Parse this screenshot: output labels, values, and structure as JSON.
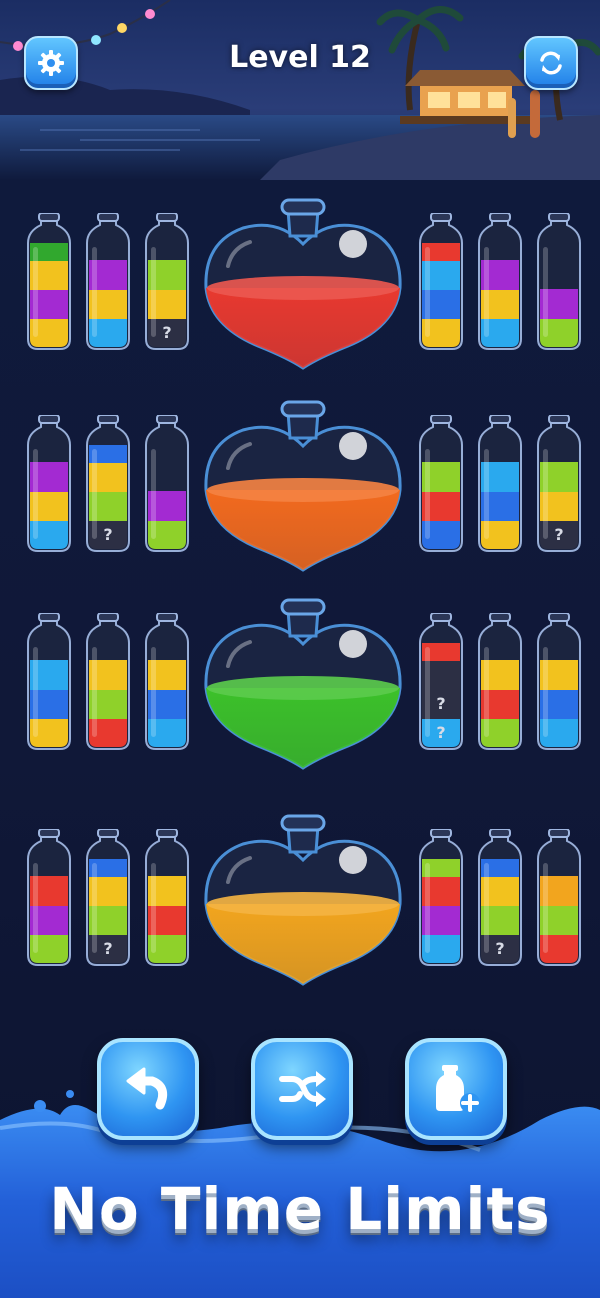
{
  "header": {
    "level_label": "Level 12",
    "settings_icon": "gear-icon",
    "restart_icon": "restart-icon"
  },
  "rows": [
    {
      "left": [
        {
          "layers": [
            "#f2c21e",
            "#a32ad2",
            "#f2c21e",
            "#31a82e",
            "#e8392f"
          ],
          "mystery": 0
        },
        {
          "layers": [
            "#2aa9ee",
            "#f2c21e",
            "#a32ad2"
          ],
          "mystery": 0
        },
        {
          "layers": [
            "#2c2f44",
            "#f2c21e",
            "#8fd12a"
          ],
          "mystery": 1
        }
      ],
      "heart": "#e8392f",
      "right": [
        {
          "layers": [
            "#f2c21e",
            "#2a6fe6",
            "#2aa9ee",
            "#e8392f"
          ],
          "mystery": 0
        },
        {
          "layers": [
            "#2aa9ee",
            "#f2c21e",
            "#a32ad2"
          ],
          "mystery": 0
        },
        {
          "layers": [
            "#8fd12a",
            "#a32ad2"
          ],
          "mystery": 0
        }
      ]
    },
    {
      "left": [
        {
          "layers": [
            "#2aa9ee",
            "#f2c21e",
            "#a32ad2"
          ],
          "mystery": 0
        },
        {
          "layers": [
            "#2c2f44",
            "#8fd12a",
            "#f2c21e",
            "#2a6fe6"
          ],
          "mystery": 1
        },
        {
          "layers": [
            "#8fd12a",
            "#a32ad2"
          ],
          "mystery": 0
        }
      ],
      "heart": "#f26a1e",
      "right": [
        {
          "layers": [
            "#2a6fe6",
            "#e8392f",
            "#8fd12a"
          ],
          "mystery": 0
        },
        {
          "layers": [
            "#f2c21e",
            "#2a6fe6",
            "#2aa9ee"
          ],
          "mystery": 0
        },
        {
          "layers": [
            "#2c2f44",
            "#f2c21e",
            "#8fd12a"
          ],
          "mystery": 1
        }
      ]
    },
    {
      "left": [
        {
          "layers": [
            "#f2c21e",
            "#2a6fe6",
            "#2aa9ee"
          ],
          "mystery": 0
        },
        {
          "layers": [
            "#e8392f",
            "#8fd12a",
            "#f2c21e"
          ],
          "mystery": 0
        },
        {
          "layers": [
            "#2aa9ee",
            "#2a6fe6",
            "#f2c21e"
          ],
          "mystery": 0
        }
      ],
      "heart": "#3cc12a",
      "right": [
        {
          "layers": [
            "#2aa9ee",
            "#2c2f44",
            "#2c2f44",
            "#e8392f"
          ],
          "mystery": 2
        },
        {
          "layers": [
            "#8fd12a",
            "#e8392f",
            "#f2c21e"
          ],
          "mystery": 0
        },
        {
          "layers": [
            "#2aa9ee",
            "#2a6fe6",
            "#f2c21e"
          ],
          "mystery": 0
        }
      ]
    },
    {
      "left": [
        {
          "layers": [
            "#8fd12a",
            "#a32ad2",
            "#e8392f"
          ],
          "mystery": 0
        },
        {
          "layers": [
            "#2c2f44",
            "#8fd12a",
            "#f2c21e",
            "#2a6fe6"
          ],
          "mystery": 1
        },
        {
          "layers": [
            "#8fd12a",
            "#e8392f",
            "#f2c21e"
          ],
          "mystery": 0
        }
      ],
      "heart": "#f2a51e",
      "right": [
        {
          "layers": [
            "#2aa9ee",
            "#a32ad2",
            "#e8392f",
            "#8fd12a"
          ],
          "mystery": 0
        },
        {
          "layers": [
            "#2c2f44",
            "#8fd12a",
            "#f2c21e",
            "#2a6fe6"
          ],
          "mystery": 1
        },
        {
          "layers": [
            "#e8392f",
            "#8fd12a",
            "#f2a51e"
          ],
          "mystery": 0
        }
      ]
    }
  ],
  "mystery_glyph": "?",
  "tools": [
    {
      "name": "undo-button",
      "icon": "undo-icon"
    },
    {
      "name": "shuffle-button",
      "icon": "shuffle-icon"
    },
    {
      "name": "add-bottle-button",
      "icon": "add-bottle-icon"
    }
  ],
  "footer": {
    "tagline": "No Time Limits"
  },
  "colors": {
    "accent": "#2f95f2",
    "wave": "#2a6ee6",
    "background": "#0f1838"
  }
}
